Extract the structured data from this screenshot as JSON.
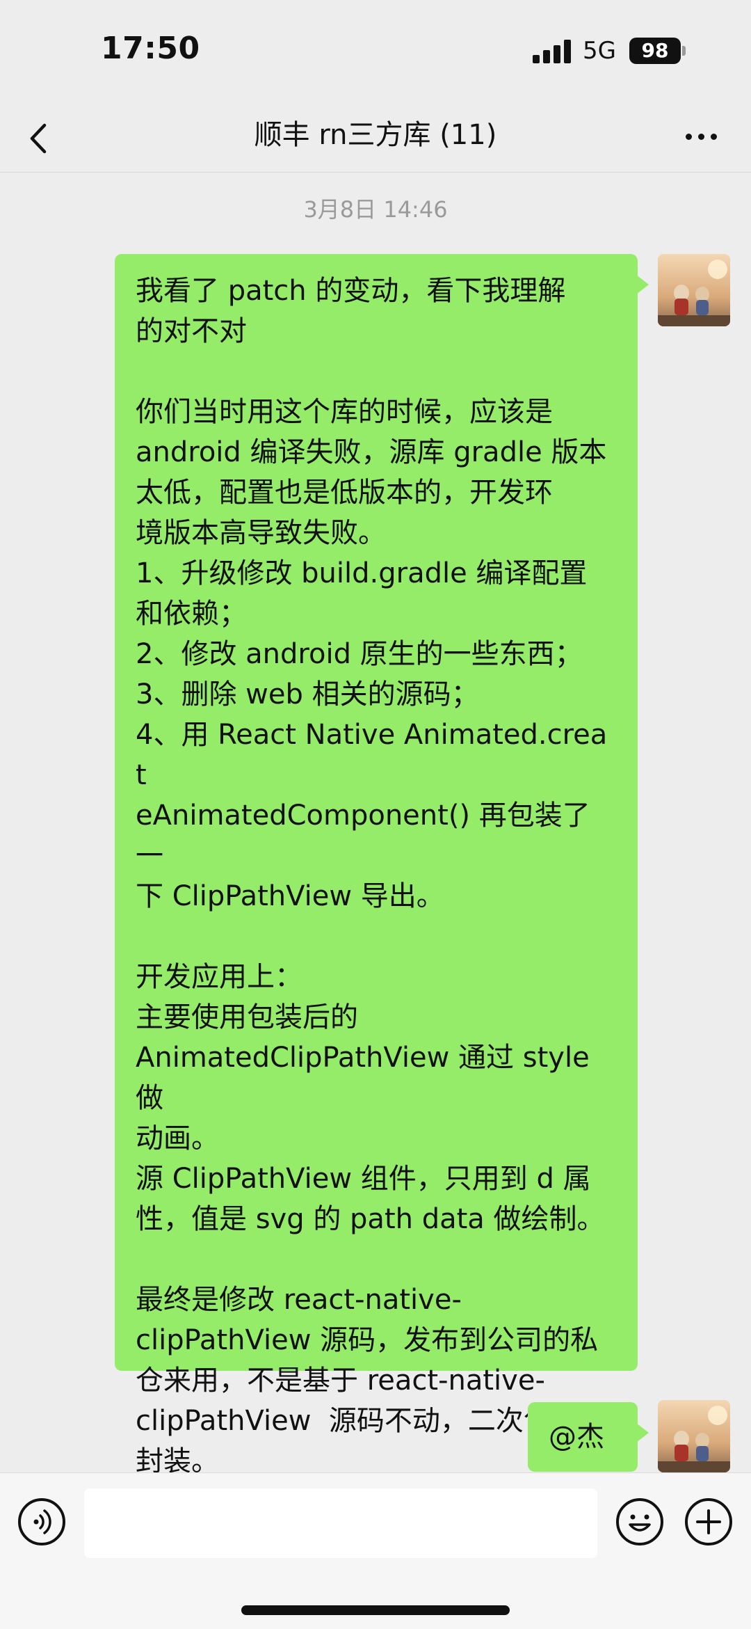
{
  "status_bar": {
    "time": "17:50",
    "network": "5G",
    "battery": "98"
  },
  "nav": {
    "title": "顺丰 rn三方库 (11)"
  },
  "chat": {
    "timestamp": "3月8日 14:46",
    "messages": [
      {
        "sender": "me",
        "text": "我看了 patch 的变动，看下我理解\n的对不对\n\n你们当时用这个库的时候，应该是\nandroid 编译失败，源库 gradle 版本\n太低，配置也是低版本的，开发环\n境版本高导致失败。\n1、升级修改 build.gradle 编译配置\n和依赖；\n2、修改 android 原生的一些东西；\n3、删除 web 相关的源码；\n4、用 React Native Animated.creat\neAnimatedComponent() 再包装了一\n下 ClipPathView 导出。\n\n开发应用上：\n主要使用包装后的\nAnimatedClipPathView 通过 style 做\n动画。\n源 ClipPathView 组件，只用到 d 属\n性，值是 svg 的 path data 做绘制。\n\n最终是修改 react-native-\nclipPathView 源码，发布到公司的私\n仓来用，不是基于 react-native-\nclipPathView  源码不动，二次包装\n封装。"
      },
      {
        "sender": "me",
        "text": "@杰"
      }
    ]
  },
  "input": {
    "placeholder": ""
  },
  "colors": {
    "bubble": "#95ec69",
    "background": "#ededed",
    "timestamp": "#9a9a9a"
  },
  "icons": [
    "chevron-left-icon",
    "more-icon",
    "voice-icon",
    "emoji-icon",
    "plus-icon",
    "signal-icon",
    "battery-icon"
  ]
}
